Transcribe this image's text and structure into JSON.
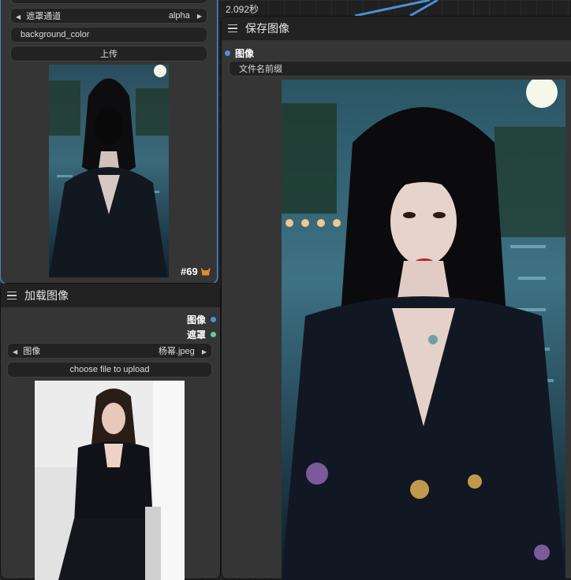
{
  "timer": "2.092秒",
  "top_node": {
    "mask_channel_label": "遮罩通道",
    "mask_channel_value": "alpha",
    "background_color_label": "background_color",
    "upload_button": "上传",
    "node_id": "#69"
  },
  "load_image_node": {
    "title": "加载图像",
    "output_image": "图像",
    "output_mask": "遮罩",
    "image_label": "图像",
    "image_value": "杨幂.jpeg",
    "choose_file_button": "choose file to upload"
  },
  "save_image_node": {
    "title": "保存图像",
    "input_image": "图像",
    "filename_prefix_label": "文件名前缀"
  },
  "colors": {
    "image_slot": "#4a90e2",
    "mask_slot": "#66cc88",
    "link": "#4a8fd6",
    "selected_border": "#4f83c9"
  },
  "icons": [
    "menu-icon",
    "fox-icon",
    "triangle-left-icon",
    "triangle-right-icon"
  ]
}
